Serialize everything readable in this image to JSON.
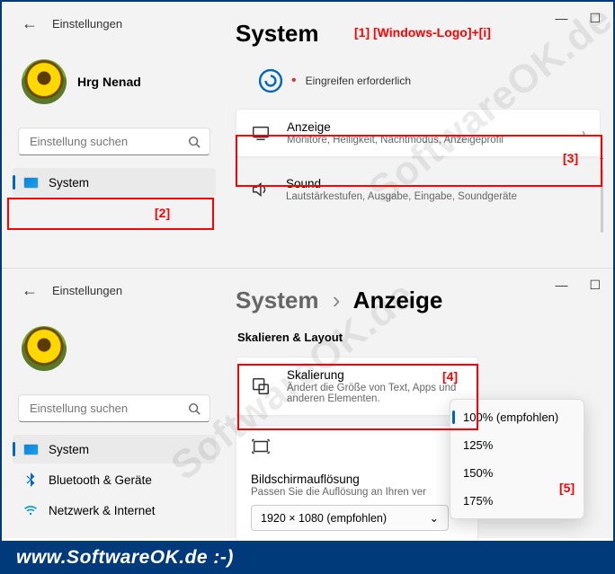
{
  "topPanel": {
    "back": "←",
    "headerLabel": "Einstellungen",
    "username": "Hrg Nenad",
    "searchPlaceholder": "Einstellung suchen",
    "nav": {
      "system": "System"
    },
    "title": "System",
    "statusText": "Eingreifen erforderlich",
    "cards": {
      "display": {
        "title": "Anzeige",
        "sub": "Monitore, Helligkeit, Nachtmodus, Anzeigeprofil"
      },
      "sound": {
        "title": "Sound",
        "sub": "Lautstärkestufen, Ausgabe, Eingabe, Soundgeräte"
      }
    }
  },
  "bottomPanel": {
    "back": "←",
    "headerLabel": "Einstellungen",
    "searchPlaceholder": "Einstellung suchen",
    "nav": {
      "system": "System",
      "bluetooth": "Bluetooth & Geräte",
      "network": "Netzwerk & Internet"
    },
    "crumbParent": "System",
    "crumbSep": "›",
    "crumbTitle": "Anzeige",
    "sectionHead": "Skalieren & Layout",
    "cards": {
      "scaling": {
        "title": "Skalierung",
        "sub": "Ändert die Größe von Text, Apps und anderen Elementen."
      },
      "resolution": {
        "title": "Bildschirmauflösung",
        "sub": "Passen Sie die Auflösung an Ihren ver"
      }
    },
    "resolutionValue": "1920 × 1080 (empfohlen)",
    "dropdown": [
      "100% (empfohlen)",
      "125%",
      "150%",
      "175%"
    ]
  },
  "annotations": {
    "a1": "[1]  [Windows-Logo]+[i]",
    "a2": "[2]",
    "a3": "[3]",
    "a4": "[4]",
    "a5": "[5]"
  },
  "watermark": "SoftwareOK.de",
  "footer": "www.SoftwareOK.de :-)"
}
